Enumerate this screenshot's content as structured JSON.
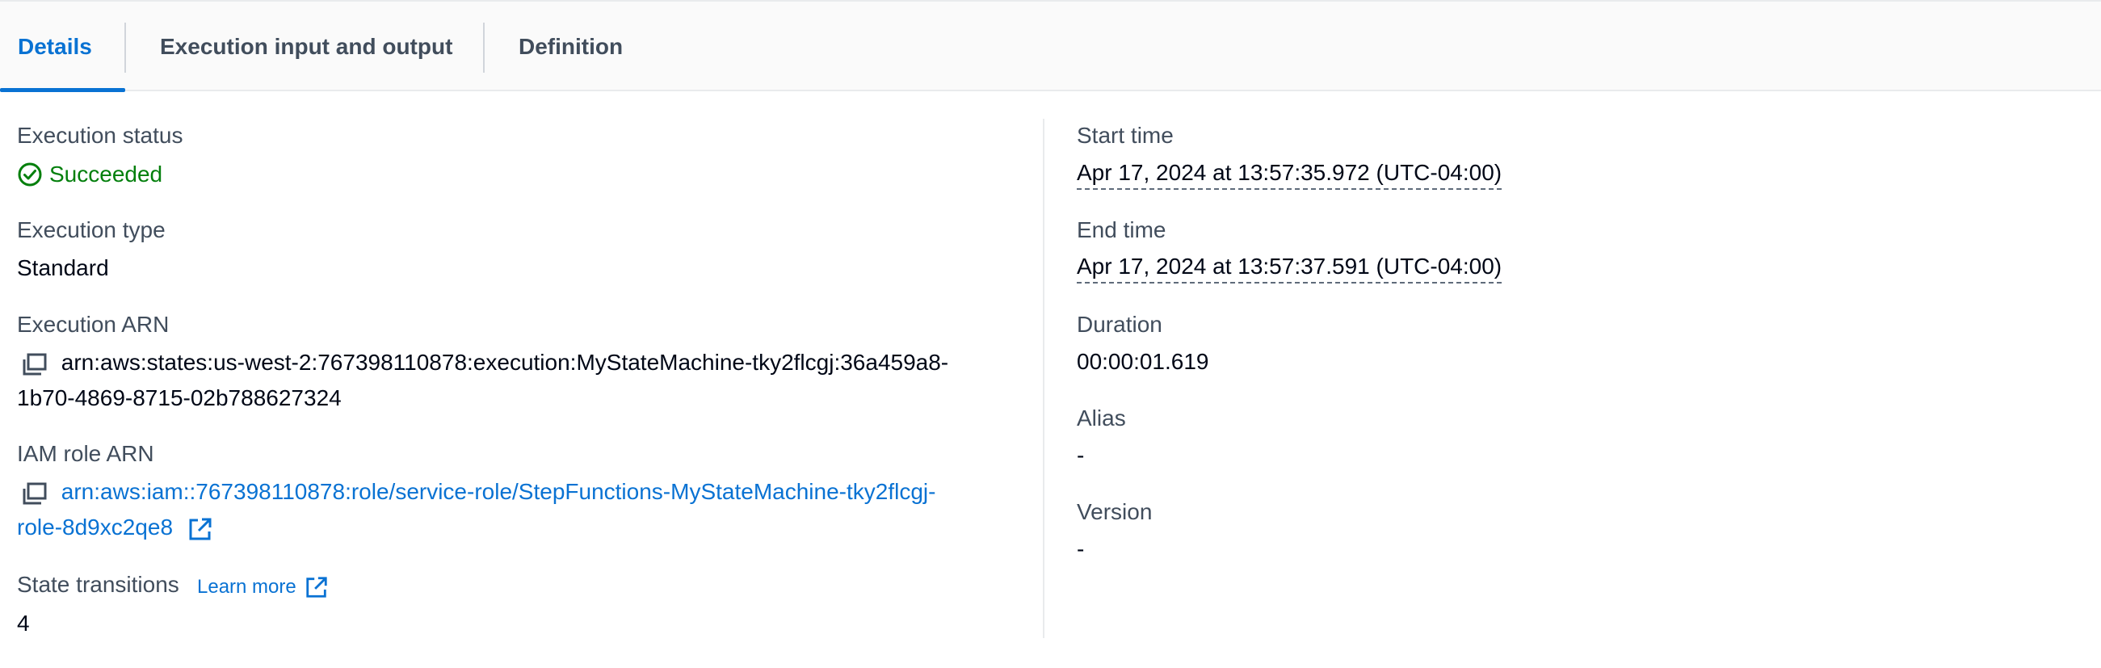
{
  "tabs": [
    {
      "label": "Details",
      "active": true
    },
    {
      "label": "Execution input and output",
      "active": false
    },
    {
      "label": "Definition",
      "active": false
    }
  ],
  "left": {
    "execution_status": {
      "label": "Execution status",
      "value": "Succeeded",
      "icon": "check-circle-icon",
      "color": "#037f0c"
    },
    "execution_type": {
      "label": "Execution type",
      "value": "Standard"
    },
    "execution_arn": {
      "label": "Execution ARN",
      "line1": "arn:aws:states:us-west-2:767398110878:execution:MyStateMachine-tky2flcgj:36a459a8-",
      "line2": "1b70-4869-8715-02b788627324"
    },
    "iam_role_arn": {
      "label": "IAM role ARN",
      "line1": "arn:aws:iam::767398110878:role/service-role/StepFunctions-MyStateMachine-tky2flcgj-",
      "line2": "role-8d9xc2qe8"
    },
    "state_transitions": {
      "label": "State transitions",
      "learn_more": "Learn more",
      "value": "4"
    }
  },
  "right": {
    "start_time": {
      "label": "Start time",
      "value": "Apr 17, 2024 at 13:57:35.972 (UTC-04:00)"
    },
    "end_time": {
      "label": "End time",
      "value": "Apr 17, 2024 at 13:57:37.591 (UTC-04:00)"
    },
    "duration": {
      "label": "Duration",
      "value": "00:00:01.619"
    },
    "alias": {
      "label": "Alias",
      "value": "-"
    },
    "version": {
      "label": "Version",
      "value": "-"
    }
  },
  "colors": {
    "link": "#0972d3",
    "success": "#037f0c",
    "label": "#414d5c"
  }
}
